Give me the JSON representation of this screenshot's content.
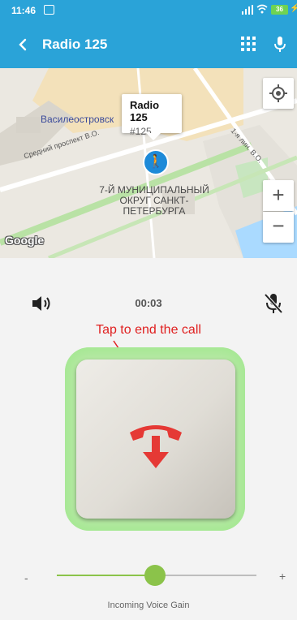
{
  "status_bar": {
    "time": "11:46",
    "battery": "36"
  },
  "app_bar": {
    "title": "Radio 125",
    "back_icon": "chevron-left-icon",
    "dialpad_icon": "dialpad-icon",
    "mic_icon": "microphone-icon"
  },
  "map": {
    "area_label": "Василеостровск",
    "street_1": "Средний проспект В.О.",
    "street_2": "1-я лин. В.О.",
    "district": "7-Й МУНИЦИПАЛЬНЫЙ ОКРУГ САНКТ-ПЕТЕРБУРГА",
    "info_title": "Radio 125",
    "info_subtitle": "#125",
    "zoom_in": "+",
    "zoom_out": "−",
    "logo": "Google"
  },
  "call": {
    "timer": "00:03",
    "hint": "Tap to end the call",
    "end_call_color": "#e53935",
    "glow_color": "#8ede6e"
  },
  "gain": {
    "minus": "-",
    "plus": "+",
    "label": "Incoming Voice Gain",
    "level": 0.49
  }
}
